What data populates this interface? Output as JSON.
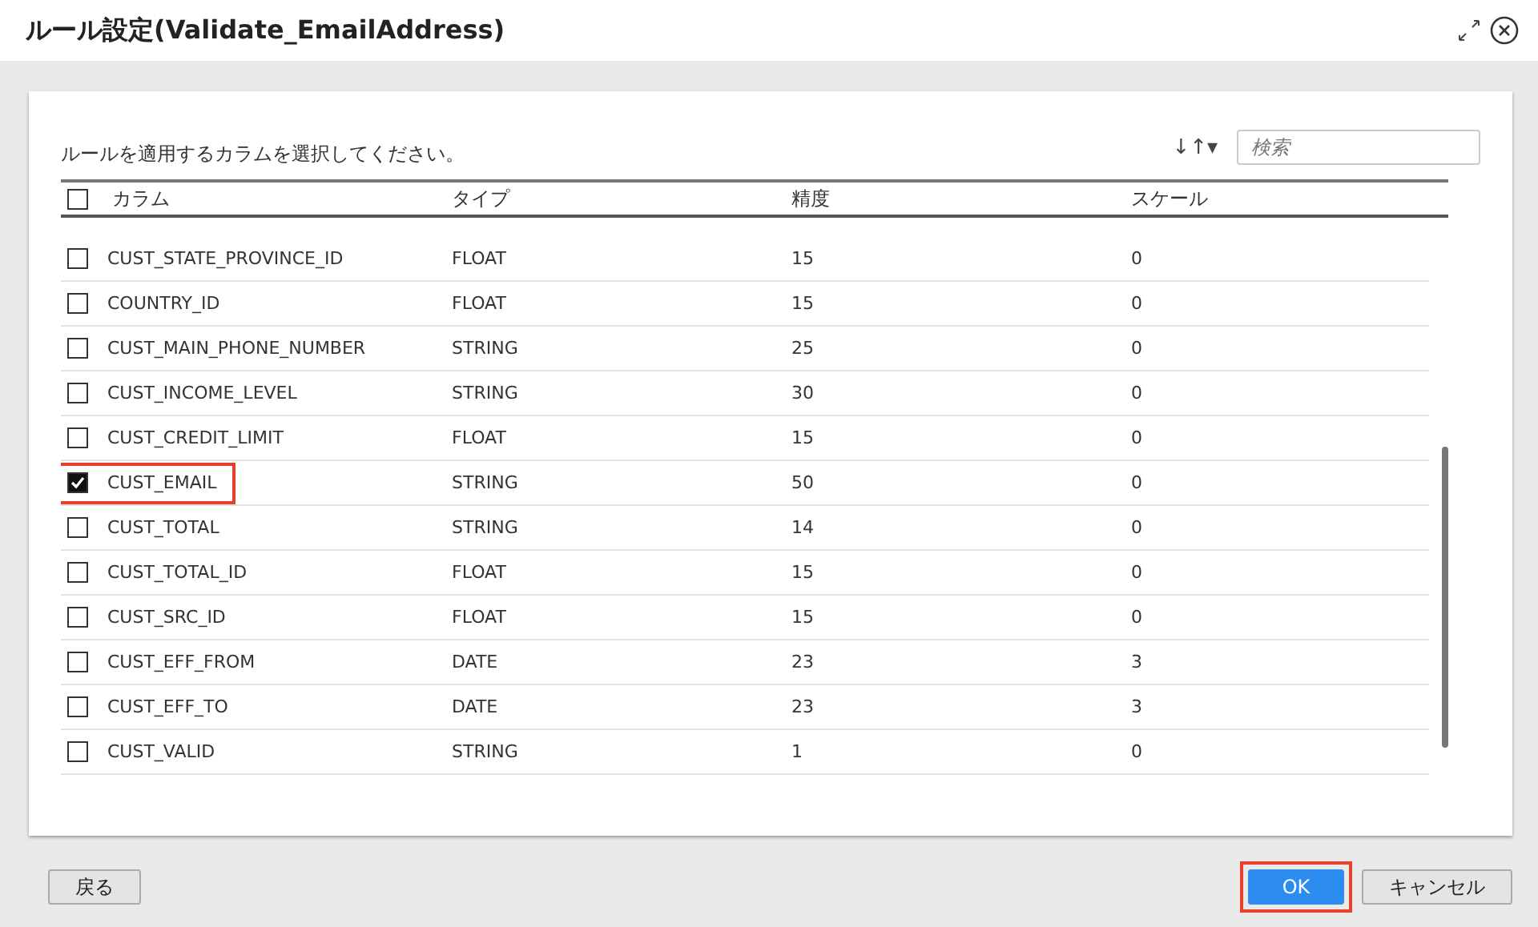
{
  "window": {
    "title": "ルール設定(Validate_EmailAddress)"
  },
  "instruction": "ルールを適用するカラムを選択してください。",
  "search": {
    "placeholder": "検索"
  },
  "sort_icon": "↓↑▾",
  "table": {
    "columns": [
      "カラム",
      "タイプ",
      "精度",
      "スケール"
    ],
    "all_checked": false,
    "rows": [
      {
        "cells": [
          "CUST_STATE_PROVINCE_ID",
          "FLOAT",
          "15",
          "0"
        ],
        "checked": false,
        "highlighted": false
      },
      {
        "cells": [
          "COUNTRY_ID",
          "FLOAT",
          "15",
          "0"
        ],
        "checked": false,
        "highlighted": false
      },
      {
        "cells": [
          "CUST_MAIN_PHONE_NUMBER",
          "STRING",
          "25",
          "0"
        ],
        "checked": false,
        "highlighted": false
      },
      {
        "cells": [
          "CUST_INCOME_LEVEL",
          "STRING",
          "30",
          "0"
        ],
        "checked": false,
        "highlighted": false
      },
      {
        "cells": [
          "CUST_CREDIT_LIMIT",
          "FLOAT",
          "15",
          "0"
        ],
        "checked": false,
        "highlighted": false
      },
      {
        "cells": [
          "CUST_EMAIL",
          "STRING",
          "50",
          "0"
        ],
        "checked": true,
        "highlighted": true
      },
      {
        "cells": [
          "CUST_TOTAL",
          "STRING",
          "14",
          "0"
        ],
        "checked": false,
        "highlighted": false
      },
      {
        "cells": [
          "CUST_TOTAL_ID",
          "FLOAT",
          "15",
          "0"
        ],
        "checked": false,
        "highlighted": false
      },
      {
        "cells": [
          "CUST_SRC_ID",
          "FLOAT",
          "15",
          "0"
        ],
        "checked": false,
        "highlighted": false
      },
      {
        "cells": [
          "CUST_EFF_FROM",
          "DATE",
          "23",
          "3"
        ],
        "checked": false,
        "highlighted": false
      },
      {
        "cells": [
          "CUST_EFF_TO",
          "DATE",
          "23",
          "3"
        ],
        "checked": false,
        "highlighted": false
      },
      {
        "cells": [
          "CUST_VALID",
          "STRING",
          "1",
          "0"
        ],
        "checked": false,
        "highlighted": false
      }
    ]
  },
  "footer": {
    "back": {
      "label": "戻る"
    },
    "ok": {
      "label": "OK",
      "highlighted": true
    },
    "cancel": {
      "label": "キャンセル"
    }
  }
}
